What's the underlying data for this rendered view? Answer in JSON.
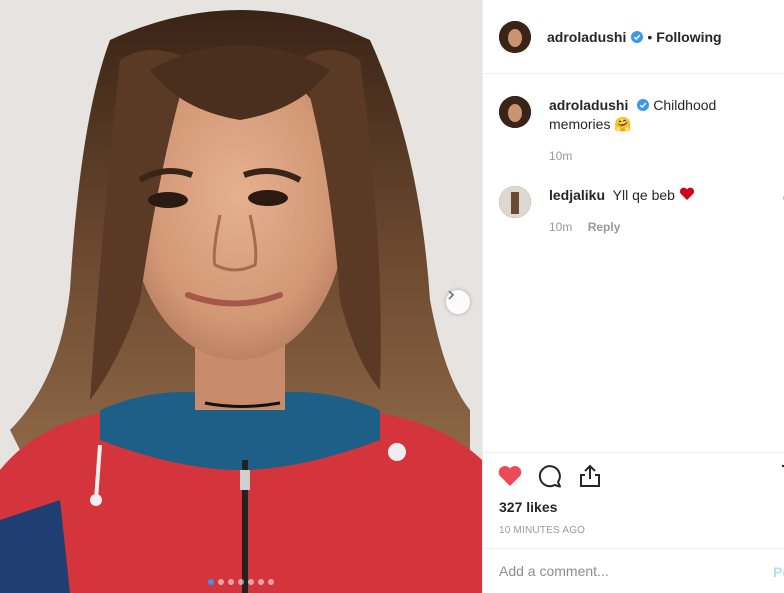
{
  "post": {
    "author": "adroladushi",
    "follow_state": "Following",
    "separator": "•",
    "caption": "Childhood memories",
    "caption_emoji": "🤗",
    "caption_time": "10m",
    "likes": "327 likes",
    "timestamp": "10 MINUTES AGO",
    "carousel": {
      "count": 7,
      "active_index": 0
    }
  },
  "comments": [
    {
      "user": "ledjaliku",
      "text": "Yll qe beb",
      "time": "10m",
      "reply_label": "Reply"
    }
  ],
  "comment_box": {
    "placeholder": "Add a comment...",
    "post_label": "Po"
  },
  "icons": {
    "like": "heart-icon",
    "comment": "comment-icon",
    "share": "share-icon",
    "save": "bookmark-icon",
    "verified": "verified-badge-icon",
    "next": "chevron-right-icon"
  },
  "colors": {
    "like_red": "#ed4956",
    "verified_blue": "#3897f0",
    "meta_gray": "#999999",
    "post_blue": "#b2dffc"
  }
}
